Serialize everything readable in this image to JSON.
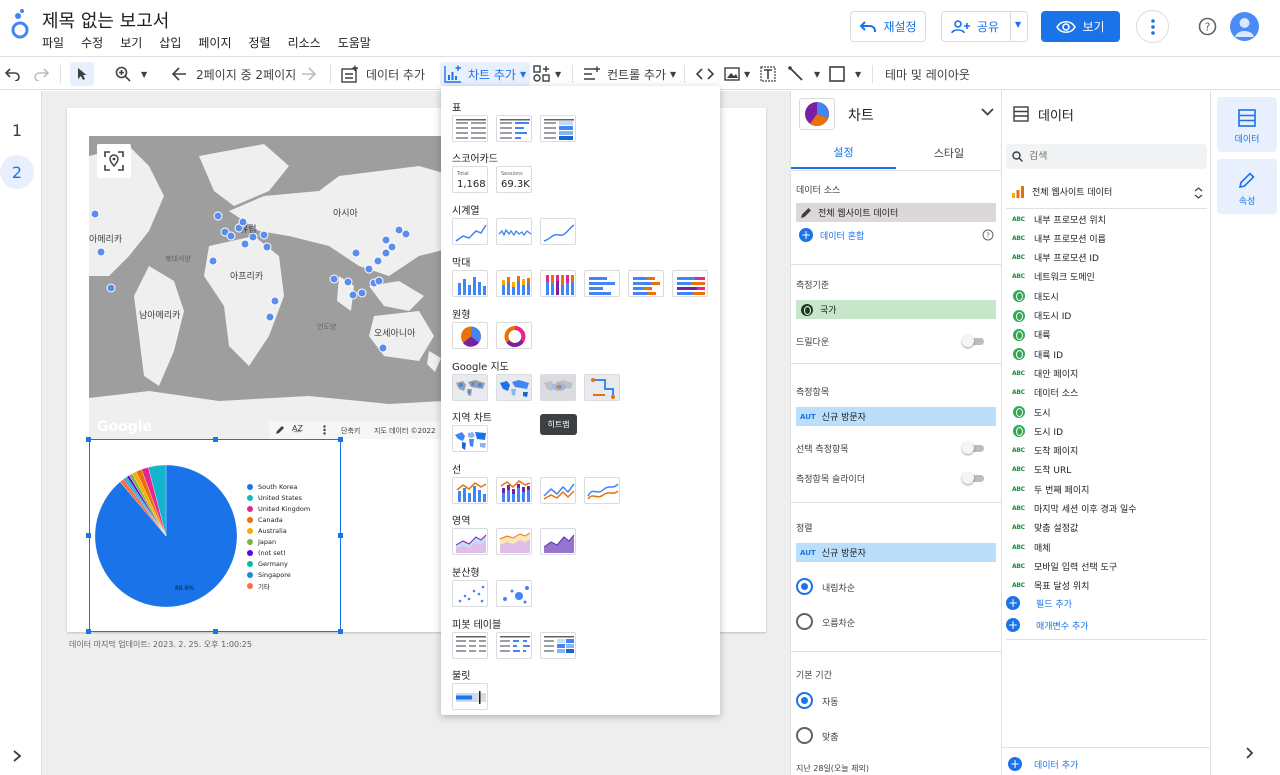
{
  "app": {
    "title": "제목 없는 보고서",
    "menu": [
      "파일",
      "수정",
      "보기",
      "삽입",
      "페이지",
      "정렬",
      "리소스",
      "도움말"
    ],
    "reset_label": "재설정",
    "share_label": "공유",
    "view_label": "보기"
  },
  "toolbar": {
    "page_nav": "2페이지 중 2페이지",
    "add_data": "데이터 추가",
    "add_chart": "차트 추가",
    "add_control": "컨트롤 추가",
    "theme_layout": "테마 및 레이아웃"
  },
  "pages": [
    "1",
    "2"
  ],
  "map": {
    "labels": [
      {
        "text": "아시아"
      },
      {
        "text": "유럽"
      },
      {
        "text": "아메리카"
      },
      {
        "text": "아프리카"
      },
      {
        "text": "남아메리카"
      },
      {
        "text": "오세아니아"
      },
      {
        "text": "북대서양"
      },
      {
        "text": "인도양"
      }
    ],
    "google": "Google",
    "shortcuts": "단축키",
    "attribution": "지도 데이터 ©2022"
  },
  "pie": {
    "legend": [
      "South Korea",
      "United States",
      "United Kingdom",
      "Canada",
      "Australia",
      "Japan",
      "(not set)",
      "Germany",
      "Singapore",
      "기타"
    ],
    "colors": [
      "#1a73e8",
      "#12b5cb",
      "#e52592",
      "#e8710a",
      "#f9ab00",
      "#7cb342",
      "#6200ea",
      "#00bfa5",
      "#1e88e5",
      "#ff6e40"
    ],
    "main_label": "88.8%"
  },
  "chart_data": {
    "type": "pie",
    "categories": [
      "South Korea",
      "United States",
      "United Kingdom",
      "Canada",
      "Australia",
      "Japan",
      "(not set)",
      "Germany",
      "Singapore",
      "기타"
    ],
    "values": [
      88.8,
      4.0,
      1.6,
      1.3,
      1.0,
      0.8,
      0.6,
      0.5,
      0.4,
      1.0
    ]
  },
  "updated": "데이터 마지막 업데이트: 2023. 2. 25. 오후 1:00:25",
  "dropdown": {
    "sections": [
      {
        "title": "표"
      },
      {
        "title": "스코어카드"
      },
      {
        "title": "시계열"
      },
      {
        "title": "막대"
      },
      {
        "title": "원형"
      },
      {
        "title": "Google 지도"
      },
      {
        "title": "지역 차트"
      },
      {
        "title": "선"
      },
      {
        "title": "영역"
      },
      {
        "title": "분산형"
      },
      {
        "title": "피봇 테이블"
      },
      {
        "title": "불릿"
      }
    ],
    "scorecards": [
      {
        "label": "Total",
        "value": "1,168"
      },
      {
        "label": "Sessions",
        "value": "69.3K"
      }
    ],
    "tooltip": "히트맵"
  },
  "props": {
    "chart_type": "차트",
    "tab_setup": "설정",
    "tab_style": "스타일",
    "data_source_label": "데이터 소스",
    "data_source": "전체 웹사이트 데이터",
    "blend": "데이터 혼합",
    "dimension_label": "측정기준",
    "dimension": "국가",
    "drilldown": "드릴다운",
    "metric_label": "측정항목",
    "metric_tag": "AUT",
    "metric": "신규 방문자",
    "optional_metric": "선택 측정항목",
    "metric_slider": "측정항목 슬라이더",
    "sort_label": "정렬",
    "sort_metric": "신규 방문자",
    "sort_desc": "내림차순",
    "sort_asc": "오름차순",
    "date_label": "기본 기간",
    "date_auto": "자동",
    "date_custom": "맞춤",
    "date_footer": "지난 28일(오늘 제외)"
  },
  "datapanel": {
    "title": "데이터",
    "search_placeholder": "검색",
    "source": "전체 웹사이트 데이터",
    "fields": [
      {
        "type": "abc",
        "name": "내부 프로모션 위치"
      },
      {
        "type": "abc",
        "name": "내부 프로모션 이름"
      },
      {
        "type": "abc",
        "name": "내부 프로모션 ID"
      },
      {
        "type": "abc",
        "name": "네트워크 도메인"
      },
      {
        "type": "geo",
        "name": "대도시"
      },
      {
        "type": "geo",
        "name": "대도시 ID"
      },
      {
        "type": "geo",
        "name": "대륙"
      },
      {
        "type": "geo",
        "name": "대륙 ID"
      },
      {
        "type": "abc",
        "name": "대안 페이지"
      },
      {
        "type": "abc",
        "name": "데이터 소스"
      },
      {
        "type": "geo",
        "name": "도시"
      },
      {
        "type": "geo",
        "name": "도시 ID"
      },
      {
        "type": "abc",
        "name": "도착 페이지"
      },
      {
        "type": "abc",
        "name": "도착 URL"
      },
      {
        "type": "abc",
        "name": "두 번째 페이지"
      },
      {
        "type": "abc",
        "name": "마지막 세션 이후 경과 일수"
      },
      {
        "type": "abc",
        "name": "맞춤 설정값"
      },
      {
        "type": "abc",
        "name": "매체"
      },
      {
        "type": "abc",
        "name": "모바일 입력 선택 도구"
      },
      {
        "type": "abc",
        "name": "목표 달성 위치"
      }
    ],
    "abc_tag": "ABC",
    "add_field": "필드 추가",
    "add_param": "매개변수 추가",
    "add_data": "데이터 추가"
  },
  "rail": {
    "data": "데이터",
    "props": "속성"
  }
}
